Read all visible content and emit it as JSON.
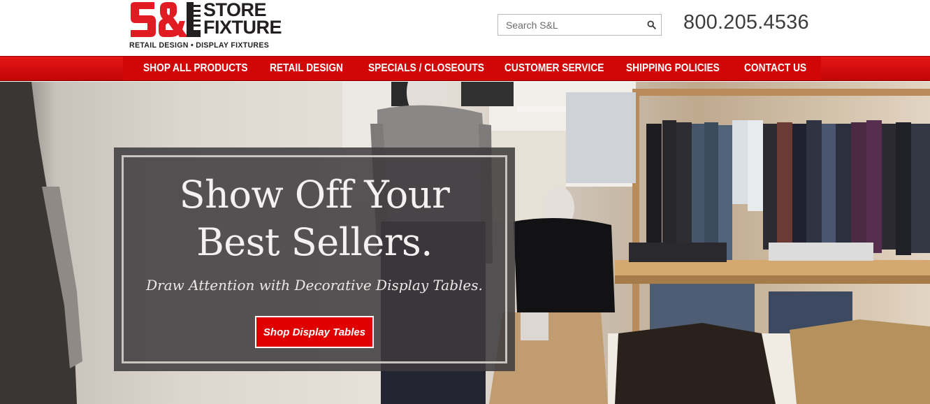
{
  "header": {
    "logo": {
      "mark_text": "S&L",
      "word_line1": "STORE",
      "word_line2": "FIXTURE",
      "tagline": "RETAIL DESIGN • DISPLAY FIXTURES"
    },
    "search": {
      "placeholder": "Search S&L",
      "icon": "search-icon"
    },
    "phone": "800.205.4536"
  },
  "nav": {
    "items": [
      {
        "label": "SHOP ALL PRODUCTS"
      },
      {
        "label": "RETAIL DESIGN"
      },
      {
        "label": "SPECIALS / CLOSEOUTS"
      },
      {
        "label": "CUSTOMER SERVICE"
      },
      {
        "label": "SHIPPING POLICIES"
      },
      {
        "label": "CONTACT US"
      }
    ]
  },
  "hero": {
    "title_line1": "Show Off Your",
    "title_line2": "Best Sellers.",
    "subtitle": "Draw Attention with Decorative Display Tables.",
    "cta_label": "Shop Display Tables"
  },
  "colors": {
    "brand_red": "#d10707",
    "button_red": "#e00000",
    "text_dark": "#231f20"
  }
}
